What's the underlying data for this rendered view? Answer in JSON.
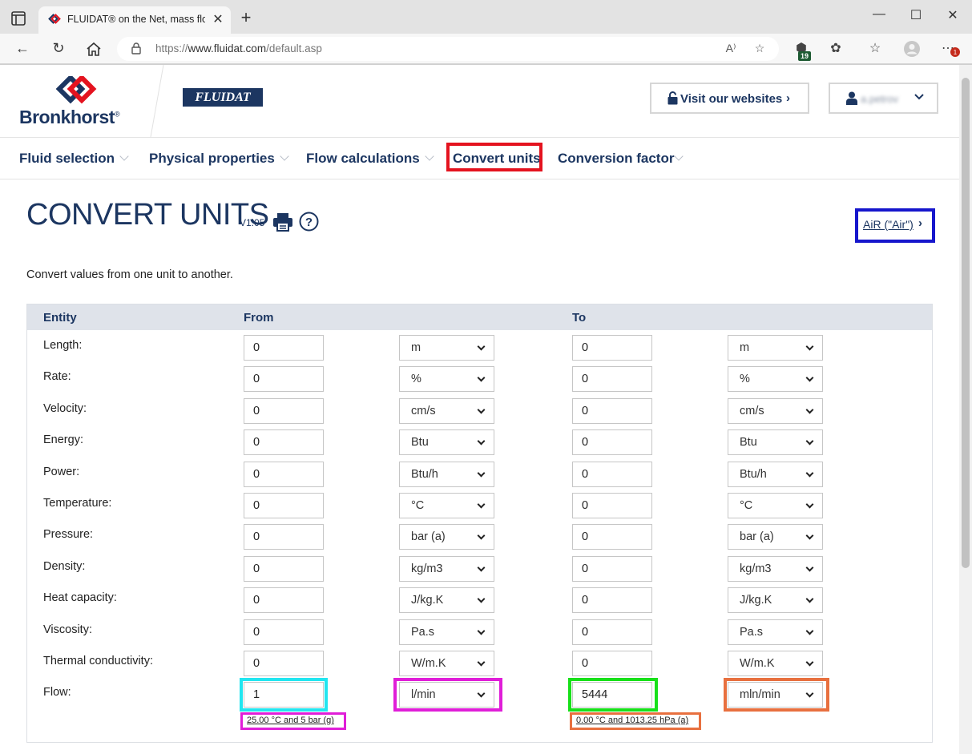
{
  "browser": {
    "tab_title": "FLUIDAT® on the Net, mass flow",
    "url_scheme": "https://",
    "url_host": "www.fluidat.com",
    "url_path": "/default.asp",
    "extension_badge": "19",
    "notification_badge": "1"
  },
  "header": {
    "brand": "Bronkhorst",
    "brand_mark": "®",
    "product": "FLUIDAT",
    "visit_label": "Visit our websites",
    "user_name": "a.petrov"
  },
  "nav": {
    "items": [
      {
        "label": "Fluid selection"
      },
      {
        "label": "Physical properties"
      },
      {
        "label": "Flow calculations"
      },
      {
        "label": "Convert units"
      },
      {
        "label": "Conversion factor"
      }
    ],
    "active": "Convert units"
  },
  "page": {
    "title": "CONVERT UNITS",
    "version": "V1.05",
    "fluid_link": "AiR (\"Air\")",
    "intro": "Convert values from one unit to another."
  },
  "table": {
    "headers": {
      "entity": "Entity",
      "from": "From",
      "to": "To"
    },
    "rows": [
      {
        "entity": "Length:",
        "from_value": "0",
        "from_unit": "m",
        "to_value": "0",
        "to_unit": "m"
      },
      {
        "entity": "Rate:",
        "from_value": "0",
        "from_unit": "%",
        "to_value": "0",
        "to_unit": "%"
      },
      {
        "entity": "Velocity:",
        "from_value": "0",
        "from_unit": "cm/s",
        "to_value": "0",
        "to_unit": "cm/s"
      },
      {
        "entity": "Energy:",
        "from_value": "0",
        "from_unit": "Btu",
        "to_value": "0",
        "to_unit": "Btu"
      },
      {
        "entity": "Power:",
        "from_value": "0",
        "from_unit": "Btu/h",
        "to_value": "0",
        "to_unit": "Btu/h"
      },
      {
        "entity": "Temperature:",
        "from_value": "0",
        "from_unit": "°C",
        "to_value": "0",
        "to_unit": "°C"
      },
      {
        "entity": "Pressure:",
        "from_value": "0",
        "from_unit": "bar (a)",
        "to_value": "0",
        "to_unit": "bar (a)"
      },
      {
        "entity": "Density:",
        "from_value": "0",
        "from_unit": "kg/m3",
        "to_value": "0",
        "to_unit": "kg/m3"
      },
      {
        "entity": "Heat capacity:",
        "from_value": "0",
        "from_unit": "J/kg.K",
        "to_value": "0",
        "to_unit": "J/kg.K"
      },
      {
        "entity": "Viscosity:",
        "from_value": "0",
        "from_unit": "Pa.s",
        "to_value": "0",
        "to_unit": "Pa.s"
      },
      {
        "entity": "Thermal conductivity:",
        "from_value": "0",
        "from_unit": "W/m.K",
        "to_value": "0",
        "to_unit": "W/m.K"
      },
      {
        "entity": "Flow:",
        "from_value": "1",
        "from_unit": "l/min",
        "to_value": "5444",
        "to_unit": "mln/min"
      }
    ],
    "flow_from_conditions": "25.00 °C and 5 bar (g)",
    "flow_to_conditions": "0.00 °C and 1013.25 hPa (a)"
  },
  "colors": {
    "brand_navy": "#1c3661",
    "brand_red": "#e4131f",
    "highlight_nav": "#e4131f",
    "highlight_fluid": "#1616cc",
    "highlight_from_value": "#22e6f0",
    "highlight_from_unit": "#e01ed8",
    "highlight_to_value": "#18e01a",
    "highlight_to_unit": "#e8703f"
  }
}
